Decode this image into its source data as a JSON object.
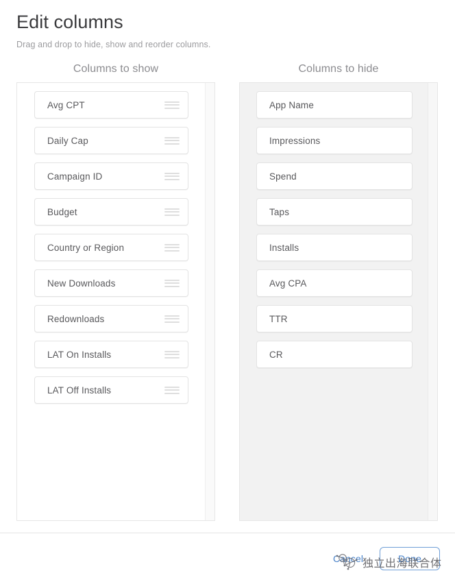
{
  "dialog": {
    "title": "Edit columns",
    "subtitle": "Drag and drop to hide, show and reorder columns."
  },
  "columns": {
    "show": {
      "heading": "Columns to show",
      "items": [
        {
          "label": "Avg CPT"
        },
        {
          "label": "Daily Cap"
        },
        {
          "label": "Campaign ID"
        },
        {
          "label": "Budget"
        },
        {
          "label": "Country or Region"
        },
        {
          "label": "New Downloads"
        },
        {
          "label": "Redownloads"
        },
        {
          "label": "LAT On Installs"
        },
        {
          "label": "LAT Off Installs"
        }
      ]
    },
    "hide": {
      "heading": "Columns to hide",
      "items": [
        {
          "label": "App Name"
        },
        {
          "label": "Impressions"
        },
        {
          "label": "Spend"
        },
        {
          "label": "Taps"
        },
        {
          "label": "Installs"
        },
        {
          "label": "Avg CPA"
        },
        {
          "label": "TTR"
        },
        {
          "label": "CR"
        }
      ]
    }
  },
  "footer": {
    "cancel_label": "Cancel",
    "done_label": "Done"
  },
  "watermark": {
    "text": "独立出海联合体"
  },
  "colors": {
    "accent": "#4680c8",
    "title_text": "#3a3a3c",
    "subtitle_text": "#9b9b9e",
    "card_text": "#58585b",
    "card_border": "#e3e3e3",
    "panel_border": "#e6e6e6",
    "hide_panel_bg": "#f2f2f2",
    "drag_handle": "#dedede"
  }
}
